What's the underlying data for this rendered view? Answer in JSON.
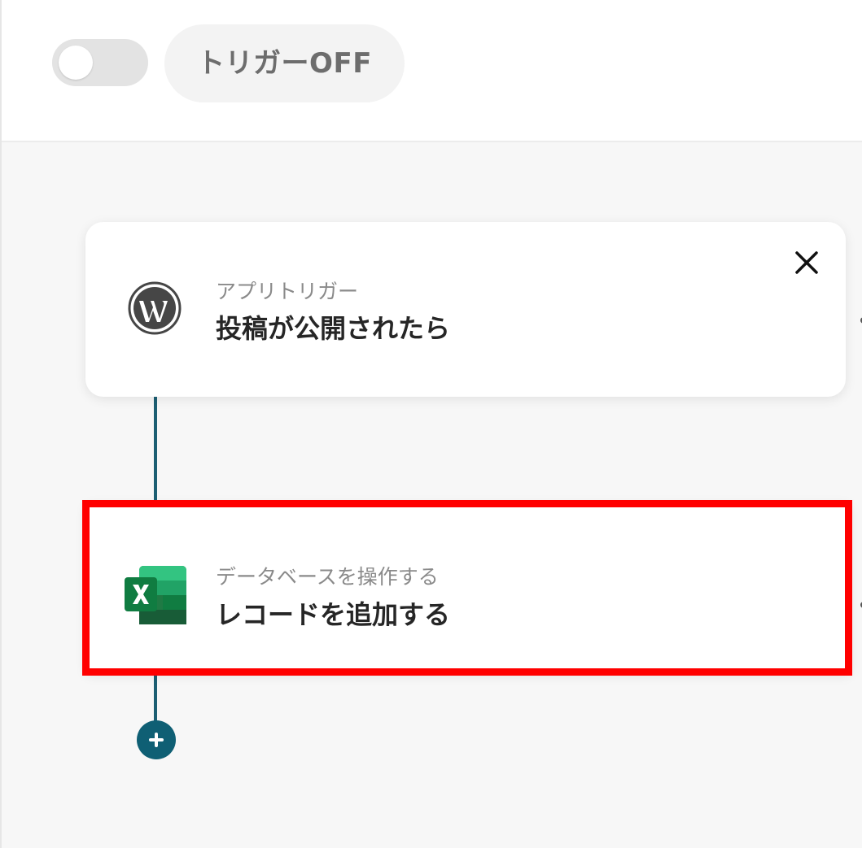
{
  "header": {
    "trigger_status_label": "トリガーOFF",
    "toggle_state": "off"
  },
  "flow": {
    "steps": [
      {
        "subtitle": "アプリトリガー",
        "title": "投稿が公開されたら",
        "icon": "wordpress-icon"
      },
      {
        "subtitle": "データベースを操作する",
        "title": "レコードを追加する",
        "icon": "excel-icon"
      }
    ],
    "add_button_icon": "plus-icon"
  },
  "colors": {
    "connector": "#1d5f73",
    "add_button": "#0f5f74",
    "highlight": "#ff0000",
    "excel_green": "#1f7a44"
  }
}
